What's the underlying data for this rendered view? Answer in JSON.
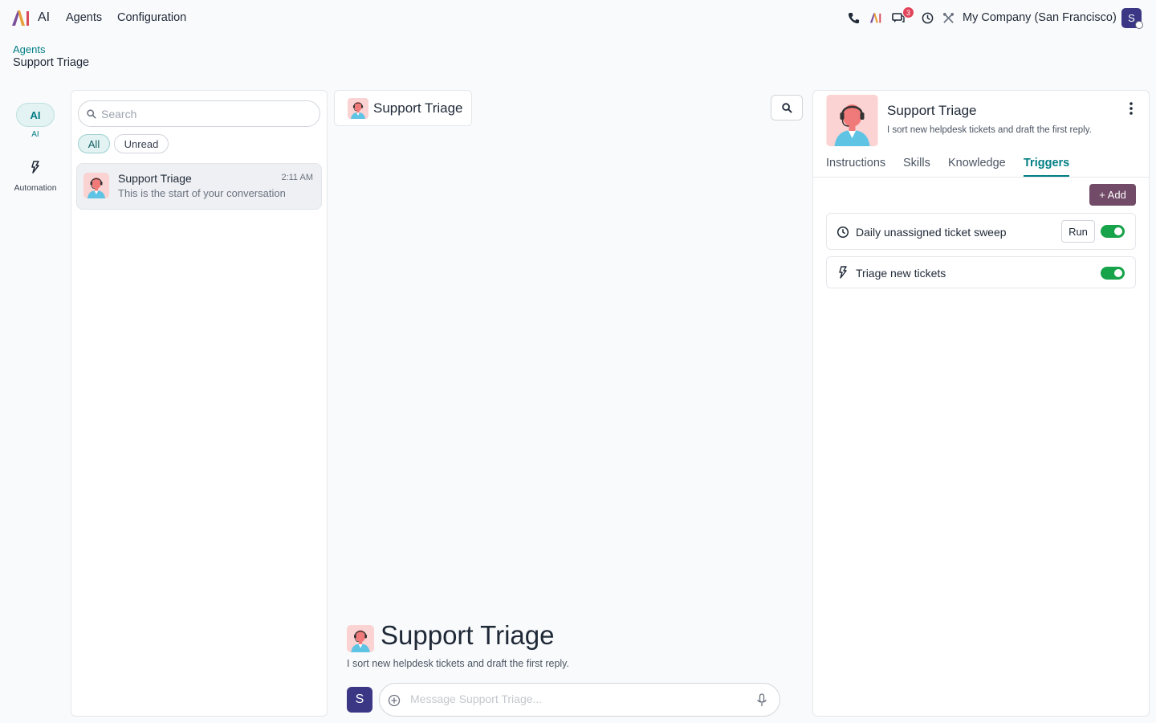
{
  "app": {
    "name": "AI"
  },
  "menu": {
    "agents": "Agents",
    "configuration": "Configuration"
  },
  "systray": {
    "messages_badge": "3",
    "company": "My Company (San Francisco)",
    "user_initial": "S"
  },
  "breadcrumb": {
    "parent": "Agents",
    "current": "Support Triage"
  },
  "rail": {
    "ai_label": "AI",
    "ai_caption": "AI",
    "automation_label": "Automation"
  },
  "conversations": {
    "search_placeholder": "Search",
    "filters": {
      "all": "All",
      "unread": "Unread"
    },
    "items": [
      {
        "name": "Support Triage",
        "time": "2:11 AM",
        "preview": "This is the start of your conversation"
      }
    ]
  },
  "chat": {
    "agent_name": "Support Triage",
    "welcome_title": "Support Triage",
    "welcome_subtitle": "I sort new helpdesk tickets and draft the first reply.",
    "composer_placeholder": "Message Support Triage...",
    "user_initial": "S"
  },
  "agent": {
    "name": "Support Triage",
    "description": "I sort new helpdesk tickets and draft the first reply.",
    "tabs": [
      "Instructions",
      "Skills",
      "Knowledge",
      "Triggers"
    ],
    "active_tab": "Triggers",
    "add_label": "+ Add",
    "triggers": [
      {
        "name": "Daily unassigned ticket sweep",
        "icon": "clock-icon",
        "run_label": "Run",
        "enabled": true
      },
      {
        "name": "Triage new tickets",
        "icon": "bolt-icon",
        "enabled": true
      }
    ]
  },
  "colors": {
    "accent": "#017e84",
    "primary_button": "#714b67",
    "toggle_on": "#16a34a",
    "badge": "#e0445a",
    "avatar_bg": "#3b3785"
  }
}
